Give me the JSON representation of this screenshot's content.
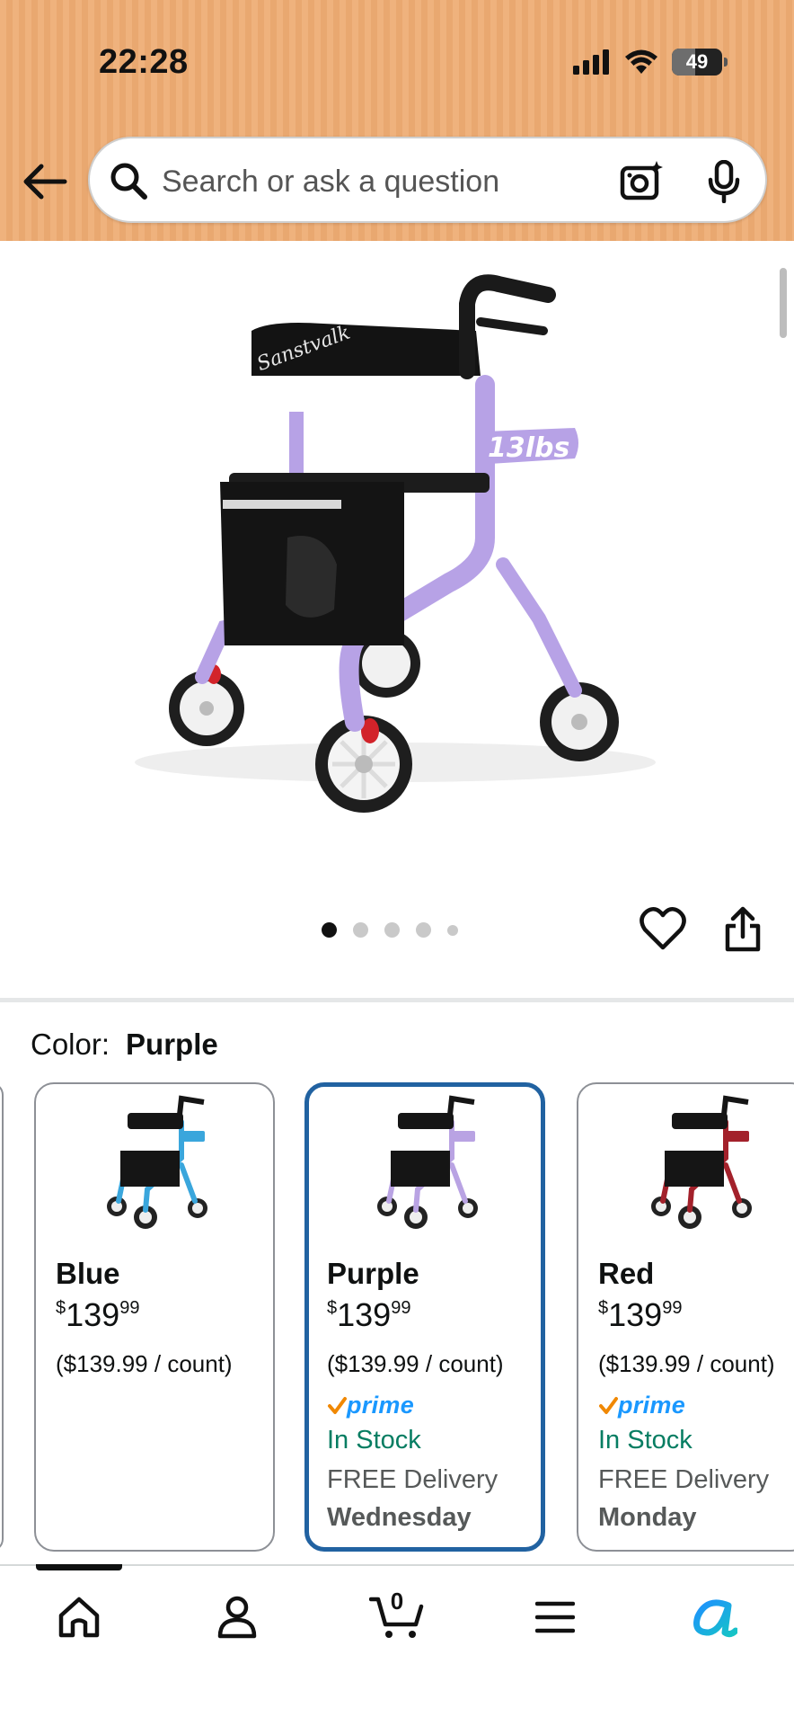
{
  "status_bar": {
    "time": "22:28",
    "battery": "49"
  },
  "search": {
    "placeholder": "Search or ask a question"
  },
  "gallery": {
    "image_tag": "13lbs",
    "brand_mark": "Sanstvalk",
    "dot_count": 5,
    "active_index": 0
  },
  "variations": {
    "label": "Color:",
    "selected": "Purple",
    "options": [
      {
        "name": "Blue",
        "price_whole": "139",
        "price_fraction": "99",
        "currency": "$",
        "unit_price": "($139.99 / count)",
        "prime": "",
        "stock": "",
        "delivery": "",
        "delivery_day": "",
        "color": "#3aa6dc"
      },
      {
        "name": "Purple",
        "price_whole": "139",
        "price_fraction": "99",
        "currency": "$",
        "unit_price": "($139.99 / count)",
        "prime": "prime",
        "stock": "In Stock",
        "delivery": "FREE Delivery",
        "delivery_day": "Wednesday",
        "color": "#b9a3e3"
      },
      {
        "name": "Red",
        "price_whole": "139",
        "price_fraction": "99",
        "currency": "$",
        "unit_price": "($139.99 / count)",
        "prime": "prime",
        "stock": "In Stock",
        "delivery": "FREE Delivery",
        "delivery_day": "Monday",
        "color": "#a3212b"
      }
    ]
  },
  "bottom_nav": {
    "items": [
      "home-icon",
      "account-icon",
      "cart-icon",
      "menu-icon",
      "rufus-icon"
    ],
    "cart_count": "0"
  },
  "colors": {
    "header": "#efb27d",
    "selected_border": "#2162a1",
    "in_stock": "#067d62",
    "prime_blue": "#1a98ff",
    "prime_check": "#f08804"
  }
}
